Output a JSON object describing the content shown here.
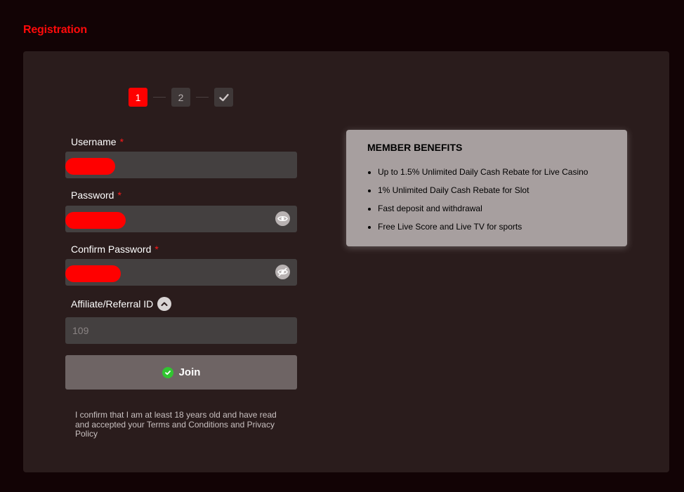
{
  "page": {
    "title": "Registration"
  },
  "stepper": {
    "steps": [
      "1",
      "2"
    ],
    "active_step": 1
  },
  "form": {
    "username_label": "Username",
    "password_label": "Password",
    "confirm_password_label": "Confirm Password",
    "required_mark": "*",
    "affiliate_label": "Affiliate/Referral ID",
    "affiliate_value": "109",
    "join_label": "Join",
    "confirm_text": "I confirm that I am at least 18 years old and have read and accepted your Terms and Conditions and Privacy Policy"
  },
  "benefits": {
    "title": "MEMBER BENEFITS",
    "items": [
      "Up to 1.5% Unlimited Daily Cash Rebate for Live Casino",
      "1% Unlimited Daily Cash Rebate for Slot",
      "Fast deposit and withdrawal",
      "Free Live Score and Live TV for sports"
    ]
  },
  "colors": {
    "accent": "#ff0a0a",
    "background": "#120305",
    "panel": "#2a1c1c",
    "input": "#444040",
    "join_button": "#6e6464",
    "benefits_card": "#a79f9f",
    "success": "#31c531"
  },
  "icons": {
    "show_password": "eye-icon",
    "hide_password": "eye-slash-icon",
    "affiliate_toggle": "chevron-up-icon",
    "join": "check-circle-icon",
    "final_step": "check-icon"
  }
}
